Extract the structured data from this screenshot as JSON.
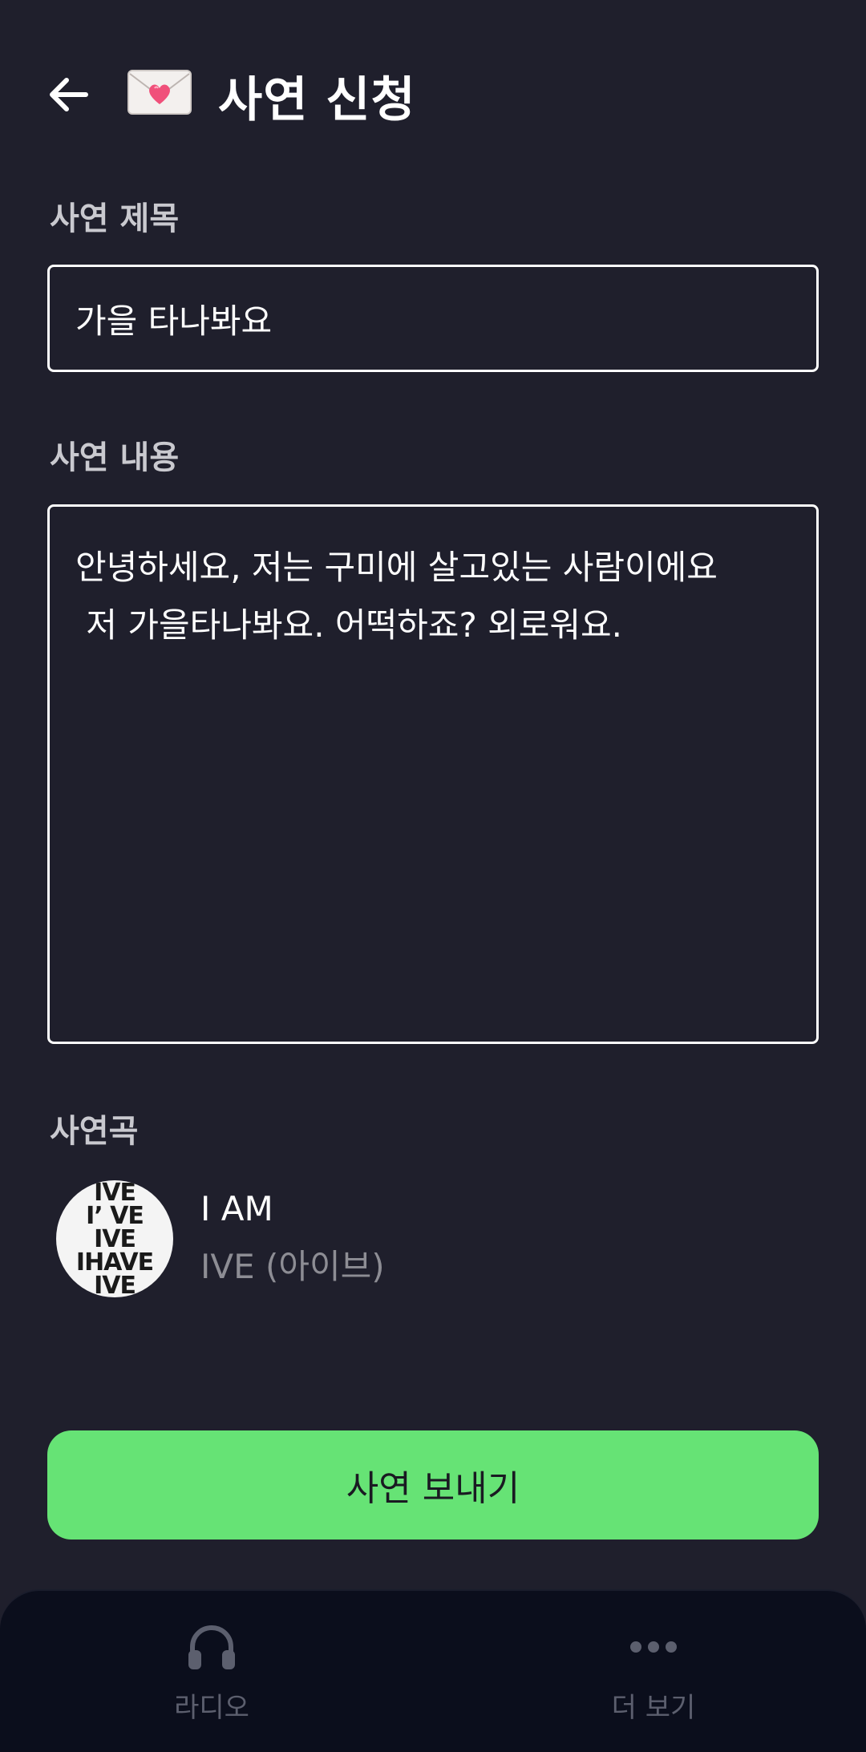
{
  "header": {
    "title": "사연 신청",
    "back_icon": "arrow-left-icon",
    "envelope_icon": "love-letter-icon"
  },
  "form": {
    "title_label": "사연 제목",
    "title_value": "가을 타나봐요",
    "content_label": "사연 내용",
    "content_value": "안녕하세요, 저는 구미에 살고있는 사람이에요\n 저 가을타나봐요. 어떡하죠? 외로워요.",
    "song_label": "사연곡"
  },
  "song": {
    "title": "I AM",
    "artist": "IVE (아이브)",
    "album_lines": [
      "IVE",
      "I’ VE",
      "IVE",
      "IHAVE",
      "IVE"
    ]
  },
  "send_button": {
    "label": "사연 보내기",
    "color": "#66e375"
  },
  "bottom_nav": {
    "items": [
      {
        "label": "라디오",
        "icon": "headphones-icon"
      },
      {
        "label": "더 보기",
        "icon": "more-dots-icon"
      }
    ]
  },
  "colors": {
    "background": "#1f1f2c",
    "nav_background": "#0b0e1c",
    "accent": "#66e375"
  }
}
